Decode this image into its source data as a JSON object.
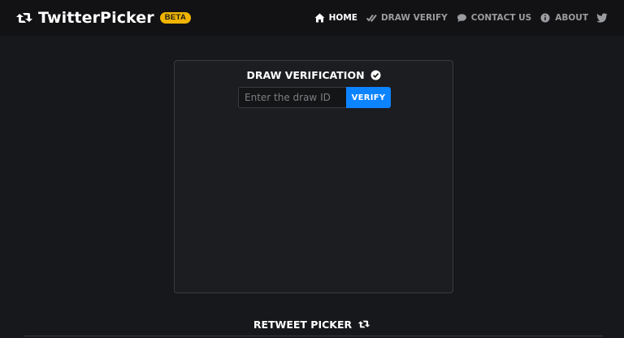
{
  "brand": {
    "name": "TwitterPicker",
    "badge": "BETA",
    "icon": "retweet-icon"
  },
  "nav": {
    "items": [
      {
        "label": "HOME",
        "icon": "home-icon",
        "active": true
      },
      {
        "label": "DRAW VERIFY",
        "icon": "double-check-icon",
        "active": false
      },
      {
        "label": "CONTACT US",
        "icon": "comment-icon",
        "active": false
      },
      {
        "label": "ABOUT",
        "icon": "info-circle-icon",
        "active": false
      }
    ],
    "social_icon": "twitter-icon"
  },
  "draw_verification": {
    "title": "DRAW VERIFICATION",
    "title_icon": "check-circle-icon",
    "input": {
      "placeholder": "Enter the draw ID",
      "value": ""
    },
    "button_label": "VERIFY"
  },
  "retweet_picker": {
    "title": "RETWEET PICKER",
    "title_icon": "retweet-icon"
  },
  "colors": {
    "background": "#17181b",
    "navbar": "#121214",
    "accent": "#0d84ff",
    "badge": "#f0b400",
    "muted_text": "#9b9c9f"
  }
}
